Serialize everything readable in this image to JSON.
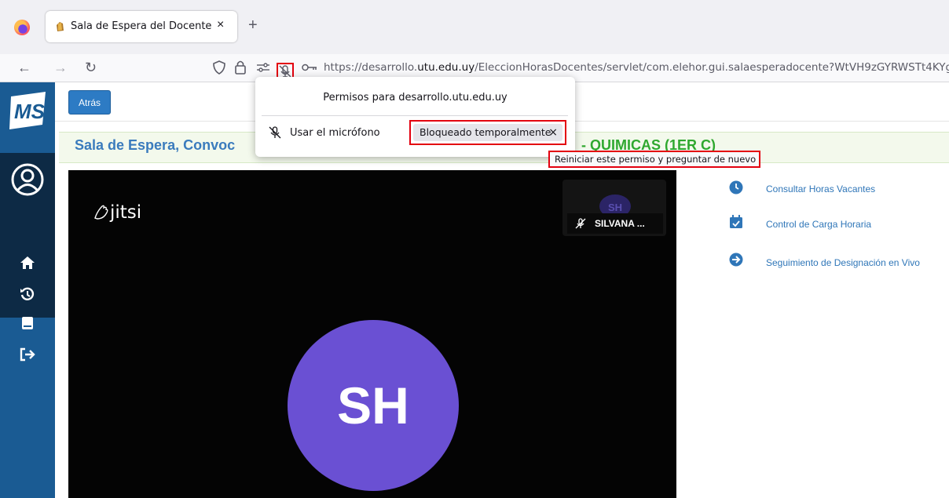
{
  "browser": {
    "tab_title": "Sala de Espera del Docente",
    "tab_close": "×",
    "new_tab": "+",
    "url_prefix": "https://desarrollo.",
    "url_domain": "utu.edu.uy",
    "url_rest": "/EleccionHorasDocentes/servlet/com.elehor.gui.salaesperadocente?WtVH9zGYRWSTt4KYg",
    "nav": {
      "back": "←",
      "forward": "→",
      "reload": "↻"
    }
  },
  "permissions_popup": {
    "title": "Permisos para desarrollo.utu.edu.uy",
    "permission_label": "Usar el micrófono",
    "permission_state": "Bloqueado temporalmente",
    "clear_symbol": "×",
    "tooltip": "Reiniciar este permiso y preguntar de nuevo"
  },
  "page": {
    "back_button": "Atrás",
    "title_left": "Sala de Espera, Convoc",
    "title_right": "- QUIMICAS (1ER C)"
  },
  "jitsi": {
    "logo": "jitsi",
    "thumb_initials": "SH",
    "thumb_name": "SILVANA ...",
    "main_initials": "SH"
  },
  "links": [
    {
      "label": "Consultar Horas Vacantes",
      "icon": "clock-icon"
    },
    {
      "label": "Control de Carga Horaria",
      "icon": "calendar-check-icon"
    },
    {
      "label": "Seguimiento de Designación en Vivo",
      "icon": "arrow-circle-icon"
    }
  ],
  "colors": {
    "sidebar": "#1a5b93",
    "accent": "#2f76b8",
    "avatar": "#6a50d3",
    "highlight": "#e3000f"
  }
}
